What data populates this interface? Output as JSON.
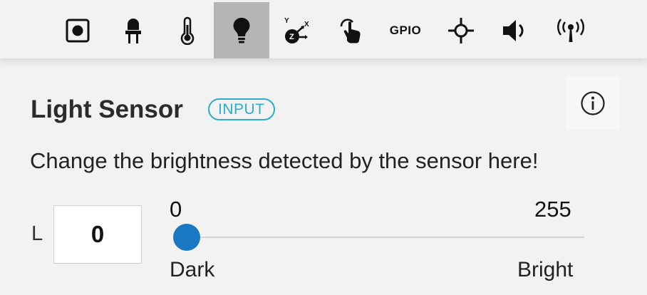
{
  "toolbar": {
    "icons": [
      "button-icon",
      "led-icon",
      "thermometer-icon",
      "lightbulb-icon",
      "accelerometer-icon",
      "touch-icon",
      "gpio-icon",
      "compass-icon",
      "speaker-icon",
      "radio-icon"
    ],
    "gpio_label": "GPIO",
    "accelerometer_axes": {
      "y": "Y",
      "x": "X",
      "z": "Z"
    },
    "active_index": 3
  },
  "panel": {
    "title": "Light Sensor",
    "badge": "INPUT",
    "description": "Change the brightness detected by the sensor here!",
    "info_icon": "info-icon"
  },
  "slider": {
    "channel_label": "L",
    "value": "0",
    "min_label": "0",
    "max_label": "255",
    "min": 0,
    "max": 255,
    "current": 0,
    "low_label": "Dark",
    "high_label": "Bright",
    "thumb_color": "#1a78c2"
  },
  "colors": {
    "accent": "#2eaccc",
    "active_tab": "#b5b5b5"
  }
}
